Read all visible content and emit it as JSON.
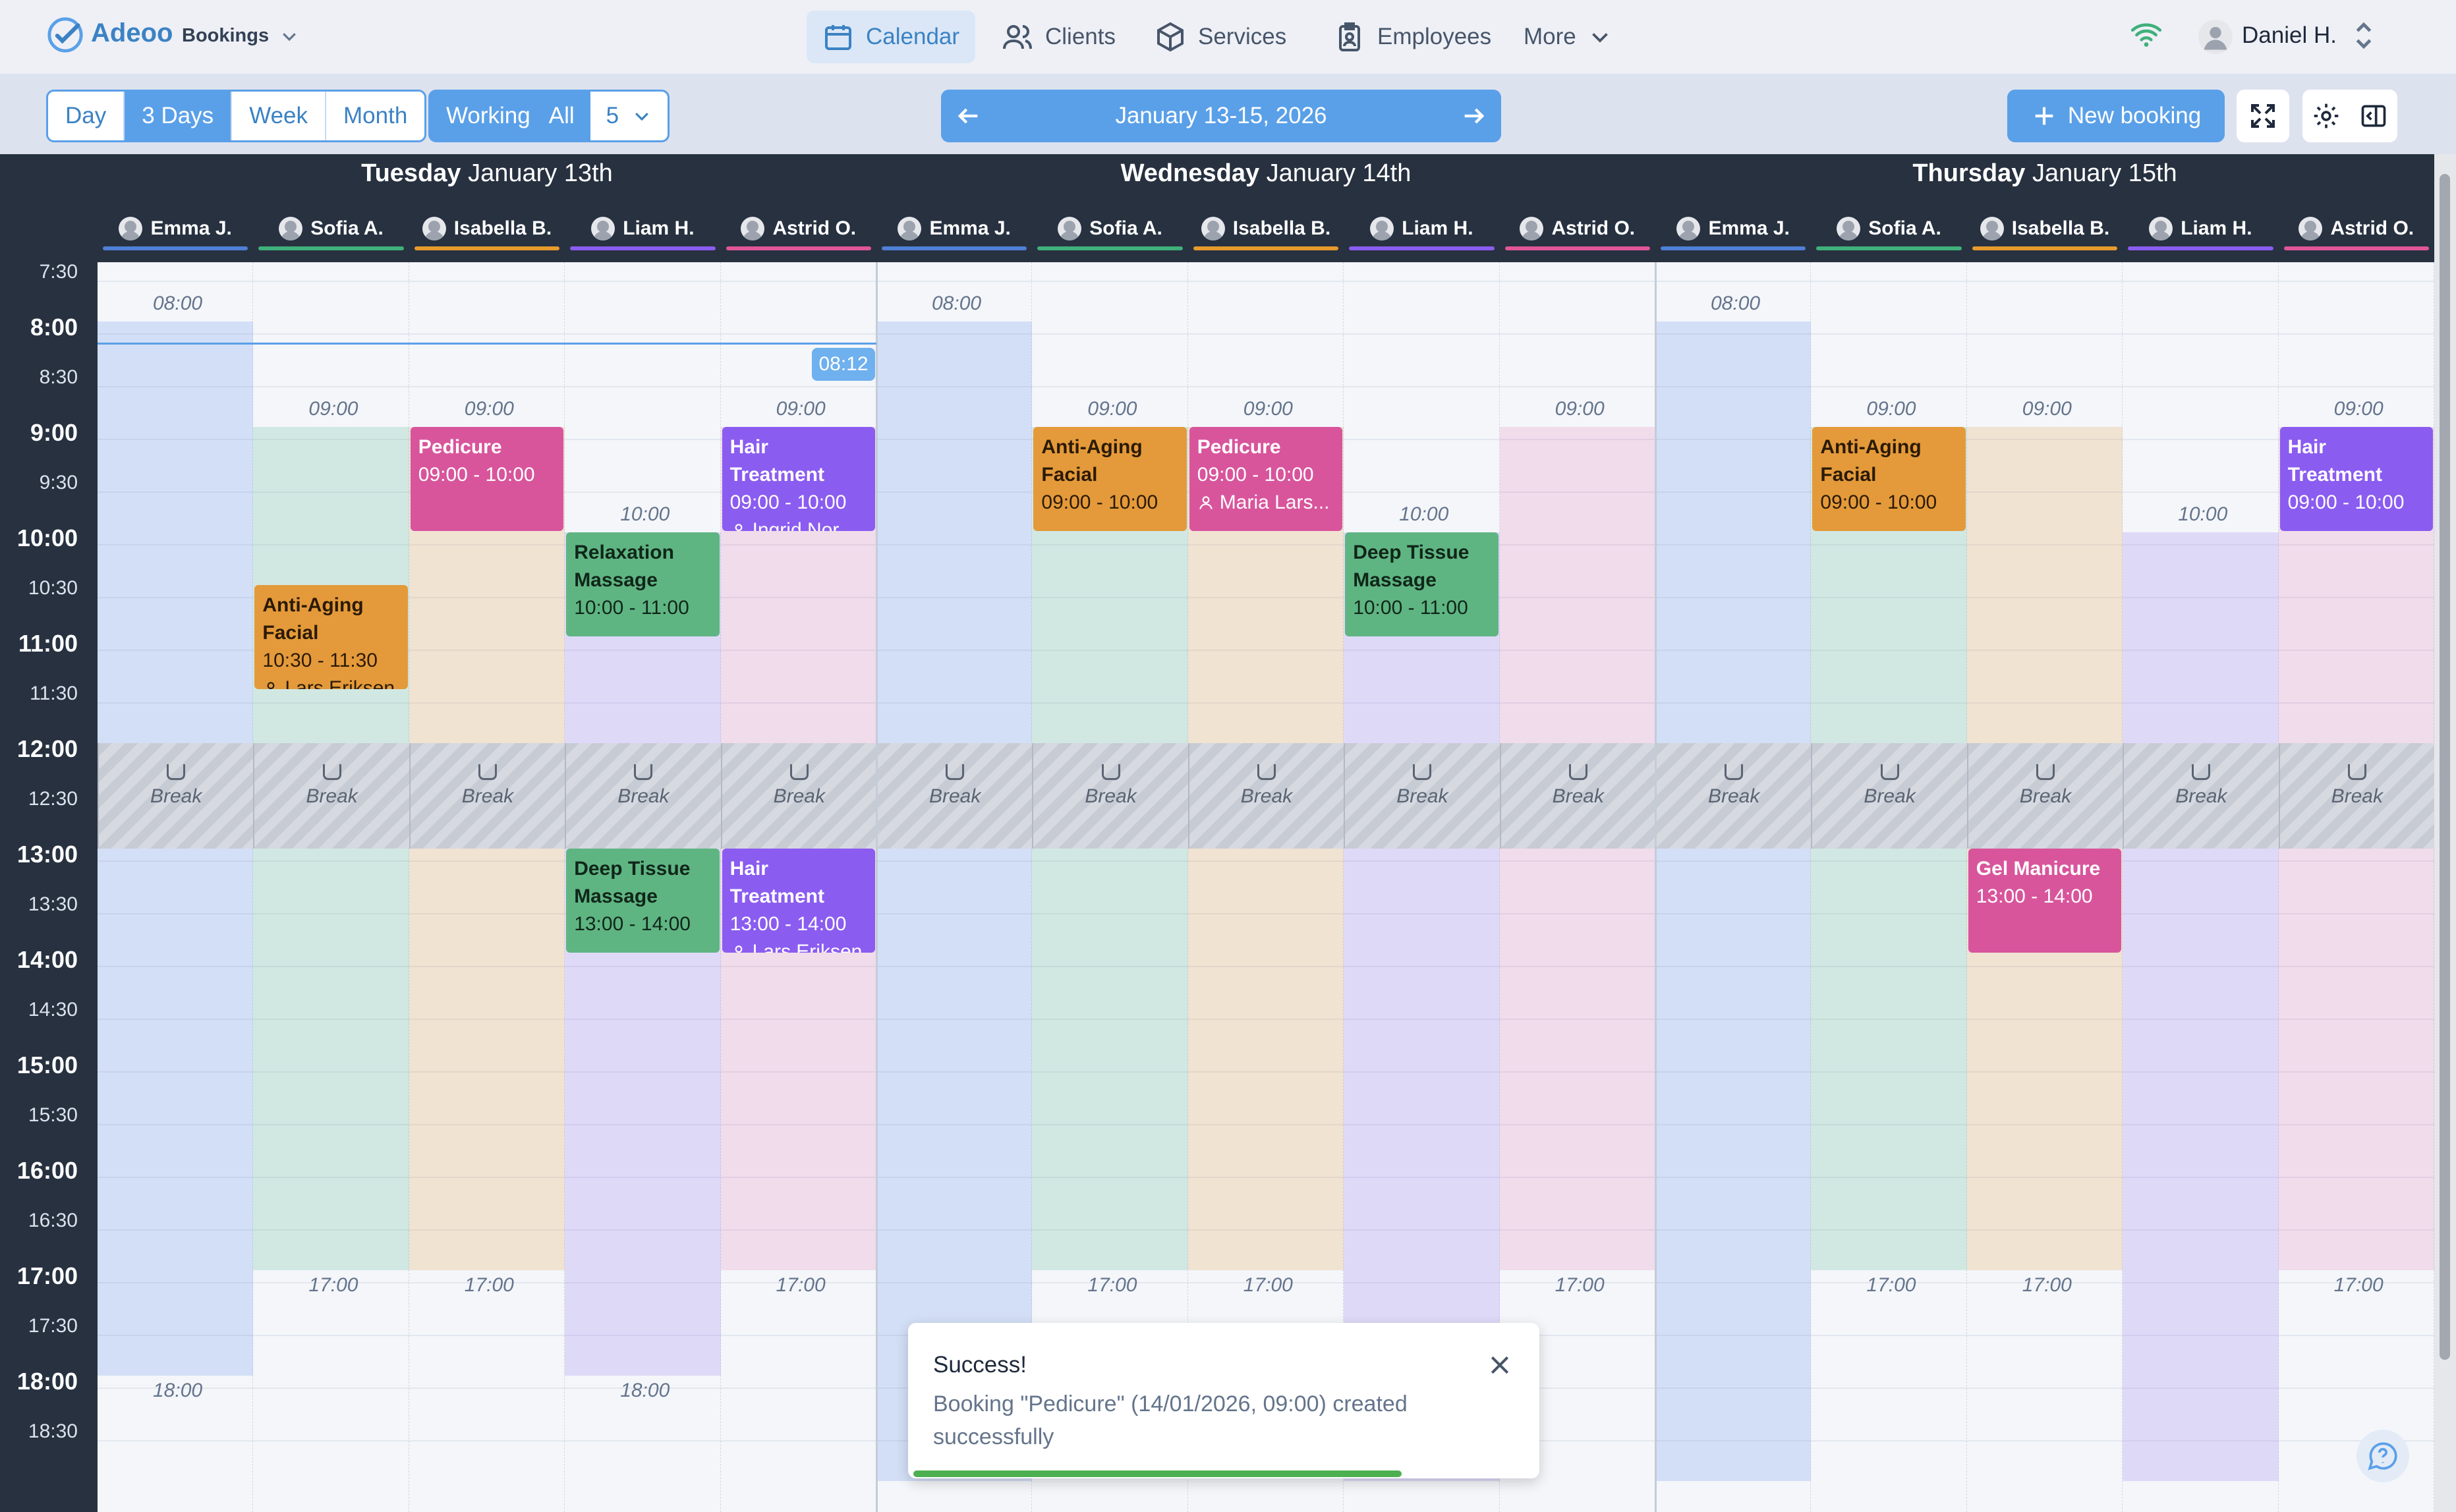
{
  "app": {
    "name": "Adeoo",
    "sub": "Bookings"
  },
  "nav": [
    {
      "label": "Calendar",
      "icon": "calendar-icon",
      "active": true
    },
    {
      "label": "Clients",
      "icon": "users-icon"
    },
    {
      "label": "Services",
      "icon": "box-icon"
    },
    {
      "label": "Employees",
      "icon": "badge-icon"
    },
    {
      "label": "More",
      "icon": "chevron-down-icon"
    }
  ],
  "user": {
    "name": "Daniel H."
  },
  "views": [
    "Day",
    "3 Days",
    "Week",
    "Month"
  ],
  "active_view": "3 Days",
  "filters": {
    "working": "Working",
    "all": "All",
    "count": "5"
  },
  "date_range": "January 13-15, 2026",
  "new_booking": "New booking",
  "days": [
    {
      "weekday": "Tuesday",
      "date": "January 13th"
    },
    {
      "weekday": "Wednesday",
      "date": "January 14th"
    },
    {
      "weekday": "Thursday",
      "date": "January 15th"
    }
  ],
  "employees": [
    {
      "name": "Emma J.",
      "color": "#4f7fd6"
    },
    {
      "name": "Sofia A.",
      "color": "#3fb07a"
    },
    {
      "name": "Isabella B.",
      "color": "#e89a2c"
    },
    {
      "name": "Liam H.",
      "color": "#8b5cf0"
    },
    {
      "name": "Astrid O.",
      "color": "#e05598"
    }
  ],
  "times": [
    "7:30",
    "8:00",
    "8:30",
    "9:00",
    "9:30",
    "10:00",
    "10:30",
    "11:00",
    "11:30",
    "12:00",
    "12:30",
    "13:00",
    "13:30",
    "14:00",
    "14:30",
    "15:00",
    "15:30",
    "16:00",
    "16:30",
    "17:00",
    "17:30",
    "18:00",
    "18:30"
  ],
  "now": "08:12",
  "break_label": "Break",
  "shifts": {
    "start": [
      [
        "08:00",
        "09:00",
        "09:00",
        "10:00",
        "09:00"
      ],
      [
        "08:00",
        "09:00",
        "09:00",
        "10:00",
        "09:00"
      ],
      [
        "08:00",
        "09:00",
        "09:00",
        "10:00",
        "09:00"
      ]
    ],
    "end": [
      [
        "18:00",
        "17:00",
        "17:00",
        "18:00",
        "17:00"
      ],
      [
        "",
        "17:00",
        "17:00",
        "",
        "17:00"
      ],
      [
        "",
        "17:00",
        "17:00",
        "",
        "17:00"
      ]
    ]
  },
  "events": [
    {
      "day": 0,
      "emp": 2,
      "title": "Pedicure",
      "time": "09:00 - 10:00",
      "color": "pink",
      "s": 9,
      "e": 10
    },
    {
      "day": 0,
      "emp": 4,
      "title": "Hair Treatment",
      "time": "09:00 - 10:00",
      "client": "Ingrid Nor...",
      "color": "purple",
      "s": 9,
      "e": 10
    },
    {
      "day": 0,
      "emp": 3,
      "title": "Relaxation Massage",
      "time": "10:00 - 11:00",
      "color": "green",
      "s": 10,
      "e": 11
    },
    {
      "day": 0,
      "emp": 1,
      "title": "Anti-Aging Facial",
      "time": "10:30 - 11:30",
      "client": "Lars Eriksen",
      "color": "orange",
      "s": 10.5,
      "e": 11.5
    },
    {
      "day": 0,
      "emp": 3,
      "title": "Deep Tissue Massage",
      "time": "13:00 - 14:00",
      "color": "green",
      "s": 13,
      "e": 14
    },
    {
      "day": 0,
      "emp": 4,
      "title": "Hair Treatment",
      "time": "13:00 - 14:00",
      "client": "Lars Eriksen",
      "color": "purple",
      "s": 13,
      "e": 14
    },
    {
      "day": 1,
      "emp": 1,
      "title": "Anti-Aging Facial",
      "time": "09:00 - 10:00",
      "color": "orange",
      "s": 9,
      "e": 10
    },
    {
      "day": 1,
      "emp": 2,
      "title": "Pedicure",
      "time": "09:00 - 10:00",
      "client": "Maria Lars...",
      "color": "pink",
      "s": 9,
      "e": 10
    },
    {
      "day": 1,
      "emp": 3,
      "title": "Deep Tissue Massage",
      "time": "10:00 - 11:00",
      "color": "green",
      "s": 10,
      "e": 11
    },
    {
      "day": 2,
      "emp": 1,
      "title": "Anti-Aging Facial",
      "time": "09:00 - 10:00",
      "color": "orange",
      "s": 9,
      "e": 10
    },
    {
      "day": 2,
      "emp": 4,
      "title": "Hair Treatment",
      "time": "09:00 - 10:00",
      "color": "purple",
      "s": 9,
      "e": 10
    },
    {
      "day": 2,
      "emp": 2,
      "title": "Gel Manicure",
      "time": "13:00 - 14:00",
      "color": "pink",
      "s": 13,
      "e": 14
    }
  ],
  "toast": {
    "title": "Success!",
    "message": "Booking \"Pedicure\" (14/01/2026, 09:00) created successfully",
    "progress": 0.78
  }
}
